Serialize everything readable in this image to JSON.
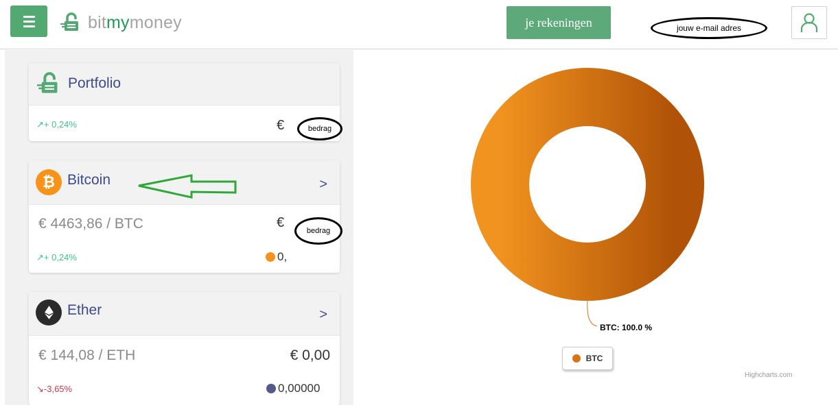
{
  "header": {
    "logo_part1": "bit",
    "logo_part2": "my",
    "logo_part3": "money",
    "accounts_label": "je rekeningen",
    "email_label": "jouw e-mail adres"
  },
  "cards": {
    "portfolio": {
      "title": "Portfolio",
      "change": "+ 0,24%",
      "currency": "€",
      "amount_label": "bedrag"
    },
    "bitcoin": {
      "title": "Bitcoin",
      "chevron": ">",
      "price": "€ 4463,86 / BTC",
      "currency": "€",
      "amount_label": "bedrag",
      "change": "+ 0,24%",
      "holding": "0,"
    },
    "ether": {
      "title": "Ether",
      "chevron": ">",
      "price": "€ 144,08 / ETH",
      "value": "€ 0,00",
      "change": "-3,65%",
      "holding": "0,00000"
    }
  },
  "chart_data": {
    "type": "pie",
    "labels": [
      "BTC"
    ],
    "values": [
      100.0
    ],
    "data_labels": [
      "BTC: 100.0 %"
    ],
    "colors": [
      "#d47517"
    ],
    "legend": [
      "BTC"
    ],
    "legend_placement": "bottom",
    "credits": "Highcharts.com"
  },
  "colors": {
    "accent_green": "#52a972",
    "title_blue": "#3e4a8d",
    "up_green": "#3ec48a",
    "down_red": "#d0394a",
    "btc_orange": "#d47517"
  },
  "icons": {
    "menu": "hamburger-icon",
    "logo": "padlock-logo-icon",
    "user": "user-icon",
    "bitcoin": "bitcoin-icon",
    "ether": "ethereum-icon",
    "arrow_up": "trend-up-icon",
    "arrow_down": "trend-down-icon"
  }
}
